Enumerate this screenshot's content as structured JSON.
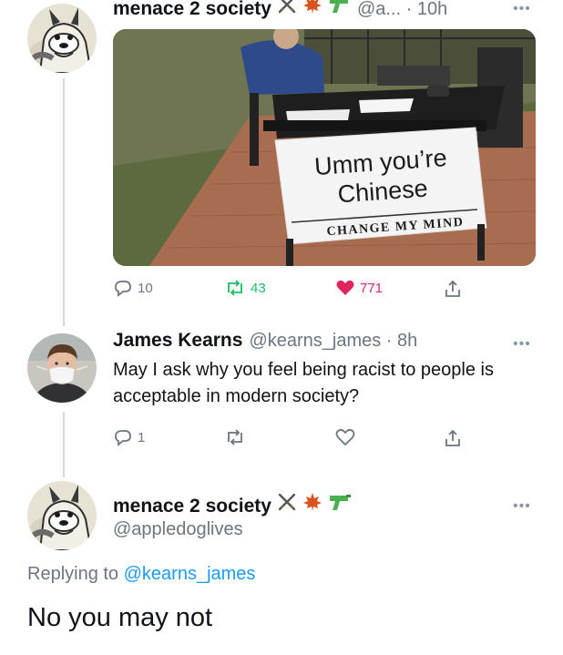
{
  "colors": {
    "accent": "#1d9bf0",
    "like": "#e0245e",
    "retweet": "#17bf63",
    "muted": "#6b7680",
    "thread_line": "#cfd9de"
  },
  "parent_tweet": {
    "author_name": "menace 2 society",
    "name_emojis": [
      "crossed-swords-icon",
      "maple-leaf-icon",
      "water-pistol-icon"
    ],
    "handle": "@a...",
    "time": "10h",
    "media": {
      "sign_text_line1": "Umm you’re",
      "sign_text_line2": "Chinese",
      "banner_text": "CHANGE MY MIND"
    },
    "replies_count": "10",
    "retweets_count": "43",
    "likes_count": "771",
    "liked": true
  },
  "reply_tweet": {
    "author_name": "James Kearns",
    "handle": "@kearns_james",
    "time": "8h",
    "text": "May I ask why you feel being racist to people is acceptable in modern society?",
    "replies_count": "1"
  },
  "main_tweet": {
    "author_name": "menace 2 society",
    "name_emojis": [
      "crossed-swords-icon",
      "maple-leaf-icon",
      "water-pistol-icon"
    ],
    "handle": "@appledoglives",
    "replying_prefix": "Replying to",
    "replying_handle": "@kearns_james",
    "text": "No you may not"
  }
}
